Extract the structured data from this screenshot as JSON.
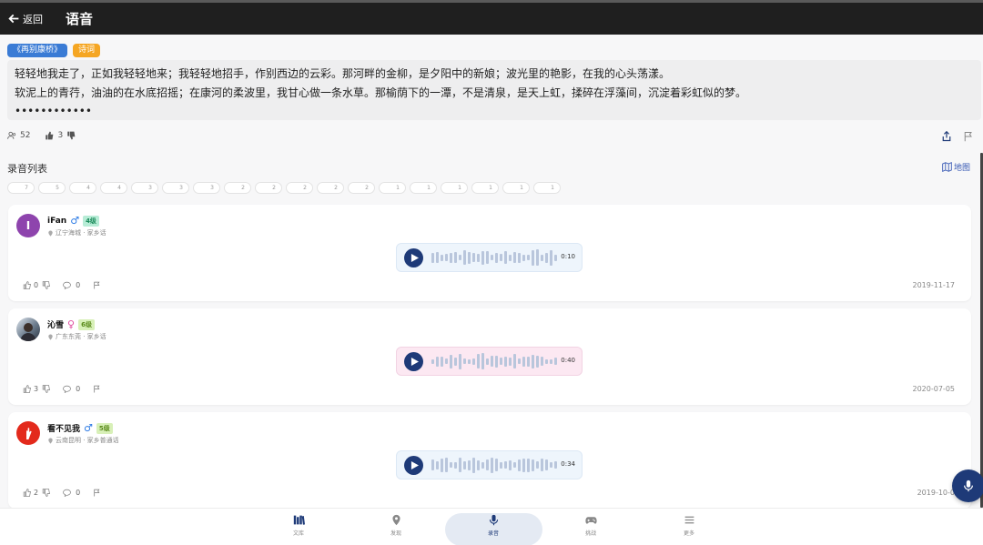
{
  "header": {
    "back_label": "返回",
    "title": "语音"
  },
  "tags": [
    {
      "label": "《再别康桥》",
      "color": "#3a7bd5"
    },
    {
      "label": "诗词",
      "color": "#f5a623"
    }
  ],
  "poem": {
    "line1": "轻轻地我走了，正如我轻轻地来；我轻轻地招手，作别西边的云彩。那河畔的金柳，是夕阳中的新娘；波光里的艳影，在我的心头荡漾。",
    "line2": "软泥上的青荇，油油的在水底招摇；在康河的柔波里，我甘心做一条水草。那榆荫下的一潭，不是清泉，是天上虹，揉碎在浮藻间，沉淀着彩虹似的梦。",
    "ellipsis": "••••••••••••"
  },
  "stats": {
    "listeners": "52",
    "likes": "3"
  },
  "recordings_section": {
    "title": "录音列表",
    "map_label": "地图"
  },
  "chips": [
    "7",
    "5",
    "4",
    "4",
    "3",
    "3",
    "3",
    "2",
    "2",
    "2",
    "2",
    "2",
    "1",
    "1",
    "1",
    "1",
    "1",
    "1"
  ],
  "recordings": [
    {
      "name": "iFan",
      "gender": "♂",
      "gender_type": "m",
      "level": "4级",
      "level_bg": "#b7ecd6",
      "level_fg": "#1a8a5a",
      "avatar_letter": "I",
      "avatar_color": "#8e44ad",
      "location": "辽宁海城 · 家乡话",
      "duration": "0:10",
      "player_style": "blue",
      "likes": "0",
      "comments": "0",
      "date": "2019-11-17"
    },
    {
      "name": "沁雪",
      "gender": "♀",
      "gender_type": "f",
      "level": "6级",
      "level_bg": "#d8f0b8",
      "level_fg": "#5a8a1a",
      "avatar_letter": "",
      "avatar_color": "#5b6b7c",
      "location": "广东东莞 · 家乡话",
      "duration": "0:40",
      "player_style": "pink",
      "likes": "3",
      "comments": "0",
      "date": "2020-07-05"
    },
    {
      "name": "看不见我",
      "gender": "♂",
      "gender_type": "m",
      "level": "5级",
      "level_bg": "#d8f0b8",
      "level_fg": "#5a8a1a",
      "avatar_letter": "",
      "avatar_color": "#e32a1c",
      "location": "云南昆明 · 家乡普通话",
      "duration": "0:34",
      "player_style": "blue",
      "likes": "2",
      "comments": "0",
      "date": "2019-10-0"
    }
  ],
  "bottom_nav": [
    {
      "label": "文库",
      "icon": "library-icon",
      "active": false
    },
    {
      "label": "发现",
      "icon": "location-pin-icon",
      "active": false
    },
    {
      "label": "录音",
      "icon": "microphone-icon",
      "active": true
    },
    {
      "label": "挑战",
      "icon": "gamepad-icon",
      "active": false
    },
    {
      "label": "更多",
      "icon": "menu-icon",
      "active": false
    }
  ],
  "colors": {
    "primary": "#1e3a78",
    "topbar": "#1f1f1f",
    "accent_blue": "#3a7bd5",
    "accent_orange": "#f5a623"
  }
}
